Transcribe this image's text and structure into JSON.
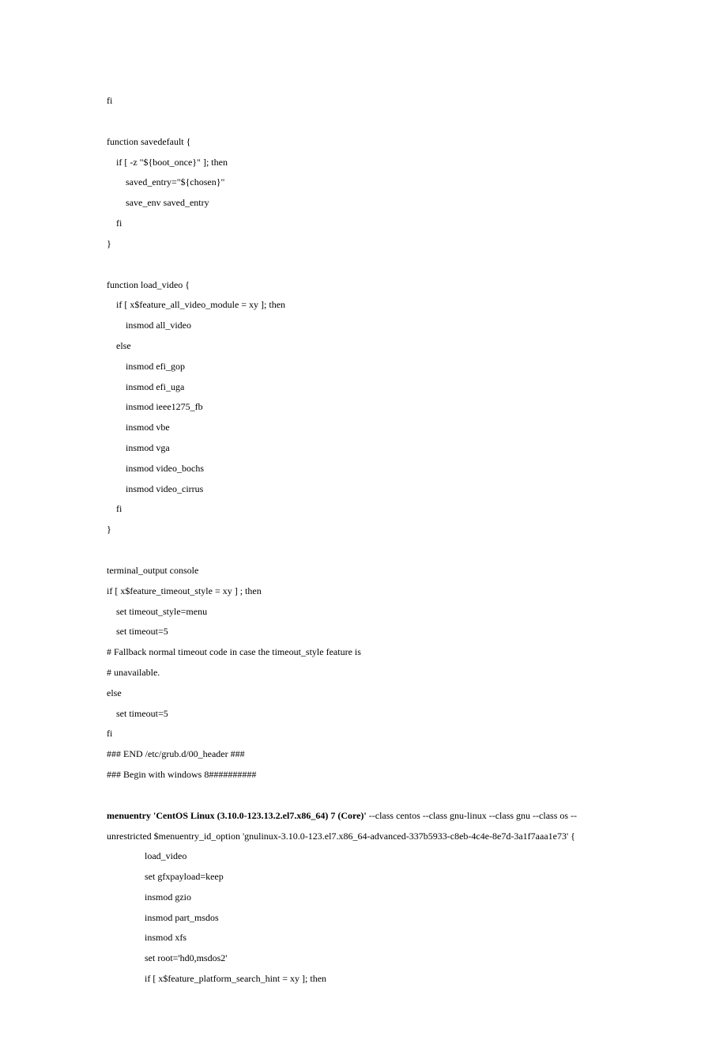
{
  "lines": [
    {
      "t": "fi",
      "i": 0
    },
    {
      "blank": true
    },
    {
      "t": "function savedefault {",
      "i": 0
    },
    {
      "t": "if [ -z \"${boot_once}\" ]; then",
      "i": 1
    },
    {
      "t": "saved_entry=\"${chosen}\"",
      "i": 2
    },
    {
      "t": "save_env saved_entry",
      "i": 2
    },
    {
      "t": "fi",
      "i": 1
    },
    {
      "t": "}",
      "i": 0
    },
    {
      "blank": true
    },
    {
      "t": "function load_video {",
      "i": 0
    },
    {
      "t": "if [ x$feature_all_video_module = xy ]; then",
      "i": 1
    },
    {
      "t": "insmod all_video",
      "i": 2
    },
    {
      "t": "else",
      "i": 1
    },
    {
      "t": "insmod efi_gop",
      "i": 2
    },
    {
      "t": "insmod efi_uga",
      "i": 2
    },
    {
      "t": "insmod ieee1275_fb",
      "i": 2
    },
    {
      "t": "insmod vbe",
      "i": 2
    },
    {
      "t": "insmod vga",
      "i": 2
    },
    {
      "t": "insmod video_bochs",
      "i": 2
    },
    {
      "t": "insmod video_cirrus",
      "i": 2
    },
    {
      "t": "fi",
      "i": 1
    },
    {
      "t": "}",
      "i": 0
    },
    {
      "blank": true
    },
    {
      "t": "terminal_output console",
      "i": 0
    },
    {
      "t": "if [ x$feature_timeout_style = xy ] ; then",
      "i": 0
    },
    {
      "t": "set timeout_style=menu",
      "i": 1
    },
    {
      "t": "set timeout=5",
      "i": 1
    },
    {
      "t": "# Fallback normal timeout code in case the timeout_style feature is",
      "i": 0
    },
    {
      "t": "# unavailable.",
      "i": 0
    },
    {
      "t": "else",
      "i": 0
    },
    {
      "t": "set timeout=5",
      "i": 1
    },
    {
      "t": "fi",
      "i": 0
    },
    {
      "t": "### END /etc/grub.d/00_header ###",
      "i": 0
    },
    {
      "t": "### Begin with windows 8##########",
      "i": 0
    },
    {
      "blank": true
    },
    {
      "special": "menuentry",
      "i": 0,
      "bold": "menuentry 'CentOS Linux (3.10.0-123.13.2.el7.x86_64) 7 (Core)'",
      "rest": " --class centos --class gnu-linux --class gnu --class os --unrestricted $menuentry_id_option 'gnulinux-3.10.0-123.el7.x86_64-advanced-337b5933-c8eb-4c4e-8e7d-3a1f7aaa1e73' {"
    },
    {
      "t": "load_video",
      "i": 3
    },
    {
      "t": "set gfxpayload=keep",
      "i": 3
    },
    {
      "t": "insmod gzio",
      "i": 3
    },
    {
      "t": "insmod part_msdos",
      "i": 3
    },
    {
      "t": "insmod xfs",
      "i": 3
    },
    {
      "t": "set root='hd0,msdos2'",
      "i": 3
    },
    {
      "t": "if [ x$feature_platform_search_hint = xy ]; then",
      "i": 3
    }
  ],
  "indent": {
    "0": "",
    "1": "    ",
    "2": "        ",
    "3": "                "
  }
}
